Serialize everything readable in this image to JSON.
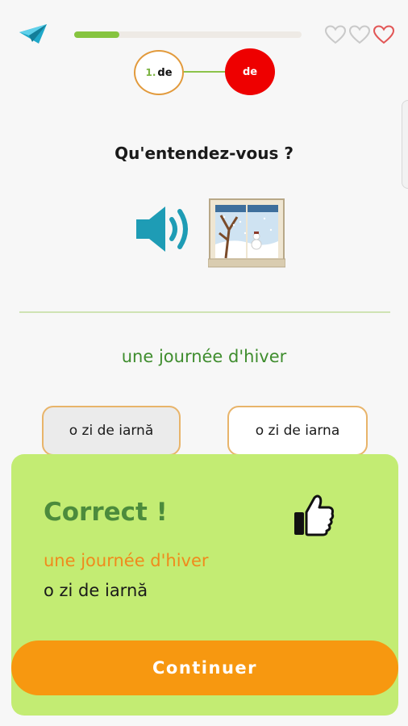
{
  "header": {
    "back_icon": "paper-plane-back-icon",
    "progress_fraction": 0.2,
    "lives": 3,
    "heart_colors": [
      "#c9c9c9",
      "#c9c9c9",
      "#e25656"
    ]
  },
  "steps": [
    {
      "number": "1.",
      "label": "de",
      "state": "current"
    },
    {
      "label": "de",
      "state": "target",
      "color": "#ee0000"
    }
  ],
  "exercise": {
    "question": "Qu'entendez-vous ?",
    "audio_icon": "speaker-icon",
    "image_icon": "winter-window-picture",
    "prompt": "une journée d'hiver"
  },
  "options": [
    {
      "label": "o zi de iarnă",
      "selected": true
    },
    {
      "label": "o zi de iarna",
      "selected": false
    }
  ],
  "result": {
    "title": "Correct !",
    "icon": "thumbs-up-icon",
    "answer_fr": "une journée d'hiver",
    "answer_ro": "o zi de iarnă",
    "continue_label": "Continuer",
    "panel_color": "#c3ec73",
    "button_color": "#f79810"
  }
}
